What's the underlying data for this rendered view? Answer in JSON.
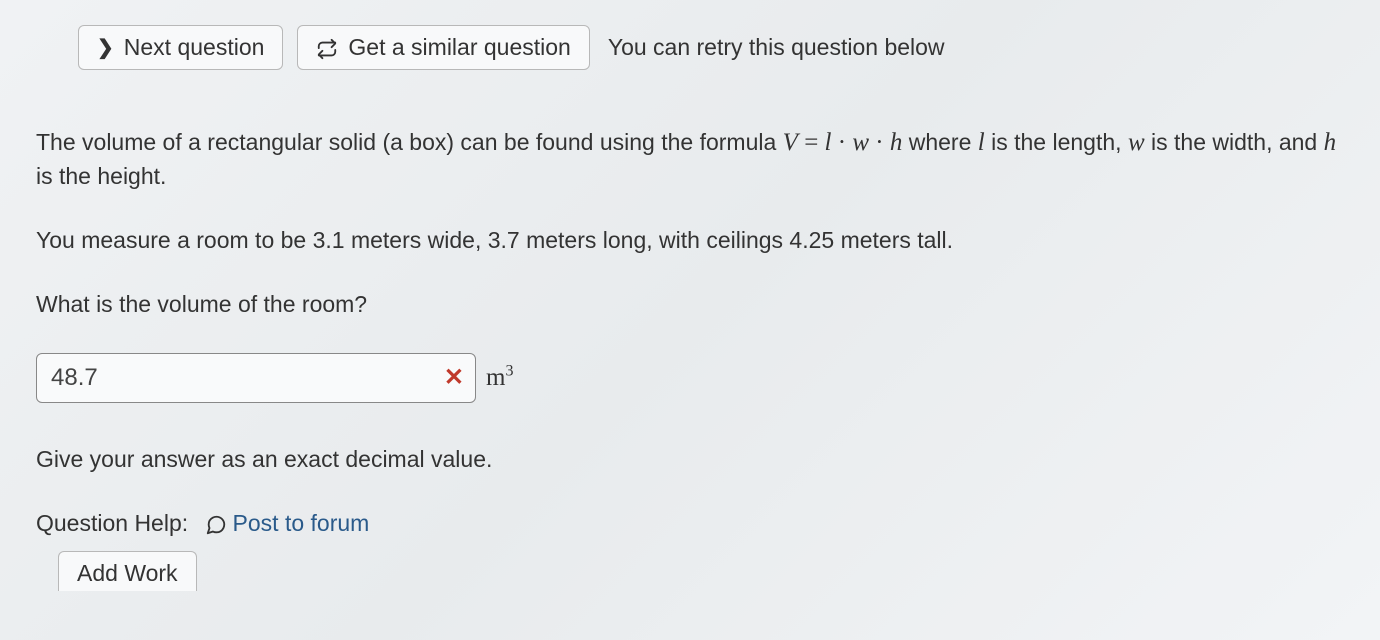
{
  "topbar": {
    "next_label": "Next question",
    "similar_label": "Get a similar question",
    "retry_text": "You can retry this question below"
  },
  "question": {
    "intro_part1": "The volume of a rectangular solid (a box) can be found using the formula ",
    "intro_part2": " where ",
    "intro_part3": " is the length, ",
    "intro_part4": " is the width, and ",
    "intro_part5": " is the height.",
    "measure_text": "You measure a room to be 3.1 meters wide, 3.7 meters long, with ceilings 4.25 meters tall.",
    "prompt": "What is the volume of the room?",
    "answer_value": "48.7",
    "unit_base": "m",
    "unit_exp": "3",
    "instruction": "Give your answer as an exact decimal value."
  },
  "help": {
    "label": "Question Help:",
    "forum_text": "Post to forum",
    "add_work": "Add Work"
  },
  "math": {
    "formula": "V = l · w · h",
    "var_l": "l",
    "var_w": "w",
    "var_h": "h"
  }
}
